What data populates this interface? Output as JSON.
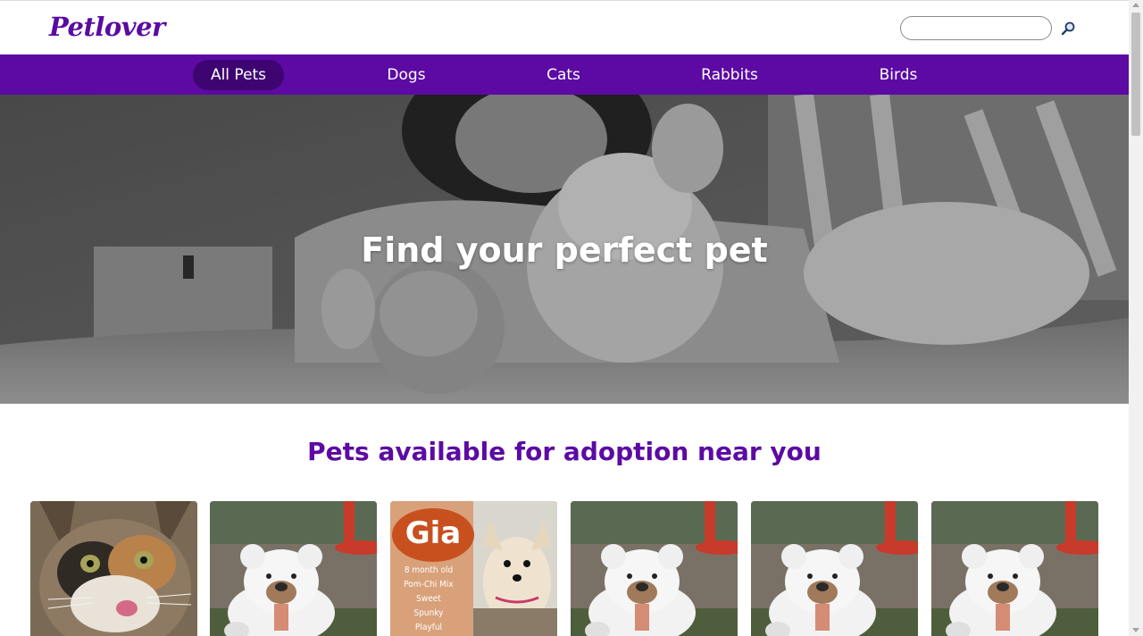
{
  "header": {
    "logo": "Petlover",
    "search": {
      "value": "",
      "placeholder": ""
    },
    "search_icon": "magnifier-icon"
  },
  "nav": {
    "items": [
      {
        "label": "All Pets",
        "active": true
      },
      {
        "label": "Dogs",
        "active": false
      },
      {
        "label": "Cats",
        "active": false
      },
      {
        "label": "Rabbits",
        "active": false
      },
      {
        "label": "Birds",
        "active": false
      }
    ]
  },
  "hero": {
    "title": "Find your perfect pet"
  },
  "main": {
    "section_title": "Pets available for adoption near you",
    "cards": [
      {
        "image": "calico-cat-photo"
      },
      {
        "image": "teddy-bear-photo"
      },
      {
        "image": "dog-poster-photo",
        "poster_name": "Gia",
        "poster_lines": [
          "8 month old",
          "Pom-Chi Mix",
          "Sweet",
          "Spunky",
          "Playful"
        ]
      },
      {
        "image": "teddy-bear-photo"
      },
      {
        "image": "teddy-bear-photo"
      },
      {
        "image": "teddy-bear-photo"
      }
    ]
  },
  "colors": {
    "brand": "#5c0aa3",
    "nav_active": "#3e0572"
  }
}
